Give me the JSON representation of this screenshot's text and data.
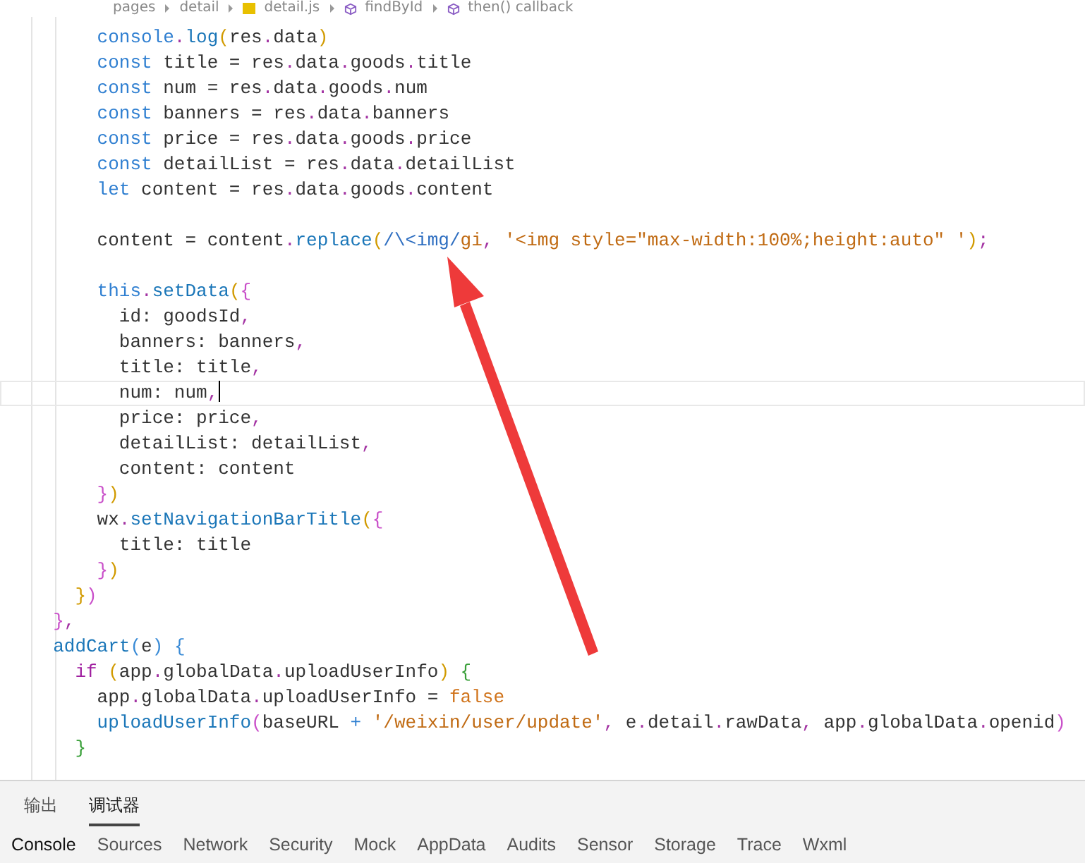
{
  "breadcrumb": [
    {
      "label": "pages",
      "kind": "folder"
    },
    {
      "label": "detail",
      "kind": "folder"
    },
    {
      "label": "detail.js",
      "kind": "file"
    },
    {
      "label": "findById",
      "kind": "method"
    },
    {
      "label": "then() callback",
      "kind": "method"
    }
  ],
  "code_lines": [
    {
      "kind": "code",
      "current": false,
      "tokens": [
        {
          "text": "      console",
          "kind": "keyword"
        },
        {
          "text": ".",
          "kind": "punct"
        },
        {
          "text": "log",
          "kind": "func"
        },
        {
          "text": "(",
          "kind": "paren"
        },
        {
          "text": "res",
          "kind": "plain"
        },
        {
          "text": ".",
          "kind": "punct"
        },
        {
          "text": "data",
          "kind": "plain"
        },
        {
          "text": ")",
          "kind": "paren"
        }
      ]
    },
    {
      "kind": "code",
      "current": false,
      "tokens": [
        {
          "text": "      const",
          "kind": "keyword"
        },
        {
          "text": " title = res",
          "kind": "plain"
        },
        {
          "text": ".",
          "kind": "punct"
        },
        {
          "text": "data",
          "kind": "plain"
        },
        {
          "text": ".",
          "kind": "punct"
        },
        {
          "text": "goods",
          "kind": "plain"
        },
        {
          "text": ".",
          "kind": "punct"
        },
        {
          "text": "title",
          "kind": "plain"
        }
      ]
    },
    {
      "kind": "code",
      "current": false,
      "tokens": [
        {
          "text": "      const",
          "kind": "keyword"
        },
        {
          "text": " num = res",
          "kind": "plain"
        },
        {
          "text": ".",
          "kind": "punct"
        },
        {
          "text": "data",
          "kind": "plain"
        },
        {
          "text": ".",
          "kind": "punct"
        },
        {
          "text": "goods",
          "kind": "plain"
        },
        {
          "text": ".",
          "kind": "punct"
        },
        {
          "text": "num",
          "kind": "plain"
        }
      ]
    },
    {
      "kind": "code",
      "current": false,
      "tokens": [
        {
          "text": "      const",
          "kind": "keyword"
        },
        {
          "text": " banners = res",
          "kind": "plain"
        },
        {
          "text": ".",
          "kind": "punct"
        },
        {
          "text": "data",
          "kind": "plain"
        },
        {
          "text": ".",
          "kind": "punct"
        },
        {
          "text": "banners",
          "kind": "plain"
        }
      ]
    },
    {
      "kind": "code",
      "current": false,
      "tokens": [
        {
          "text": "      const",
          "kind": "keyword"
        },
        {
          "text": " price = res",
          "kind": "plain"
        },
        {
          "text": ".",
          "kind": "punct"
        },
        {
          "text": "data",
          "kind": "plain"
        },
        {
          "text": ".",
          "kind": "punct"
        },
        {
          "text": "goods",
          "kind": "plain"
        },
        {
          "text": ".",
          "kind": "punct"
        },
        {
          "text": "price",
          "kind": "plain"
        }
      ]
    },
    {
      "kind": "code",
      "current": false,
      "tokens": [
        {
          "text": "      const",
          "kind": "keyword"
        },
        {
          "text": " detailList = res",
          "kind": "plain"
        },
        {
          "text": ".",
          "kind": "punct"
        },
        {
          "text": "data",
          "kind": "plain"
        },
        {
          "text": ".",
          "kind": "punct"
        },
        {
          "text": "detailList",
          "kind": "plain"
        }
      ]
    },
    {
      "kind": "code",
      "current": false,
      "tokens": [
        {
          "text": "      let",
          "kind": "keyword"
        },
        {
          "text": " content = res",
          "kind": "plain"
        },
        {
          "text": ".",
          "kind": "punct"
        },
        {
          "text": "data",
          "kind": "plain"
        },
        {
          "text": ".",
          "kind": "punct"
        },
        {
          "text": "goods",
          "kind": "plain"
        },
        {
          "text": ".",
          "kind": "punct"
        },
        {
          "text": "content",
          "kind": "plain"
        }
      ]
    },
    {
      "kind": "blank"
    },
    {
      "kind": "code",
      "current": false,
      "tokens": [
        {
          "text": "      content = content",
          "kind": "plain"
        },
        {
          "text": ".",
          "kind": "punct"
        },
        {
          "text": "replace",
          "kind": "func"
        },
        {
          "text": "(",
          "kind": "paren"
        },
        {
          "text": "/\\<img/",
          "kind": "regex"
        },
        {
          "text": "gi",
          "kind": "string"
        },
        {
          "text": ", ",
          "kind": "punct"
        },
        {
          "text": "'<img style=\"max-width:100%;height:auto\" '",
          "kind": "string"
        },
        {
          "text": ")",
          "kind": "paren"
        },
        {
          "text": ";",
          "kind": "punct"
        }
      ]
    },
    {
      "kind": "blank"
    },
    {
      "kind": "code",
      "current": false,
      "tokens": [
        {
          "text": "      this",
          "kind": "keyword"
        },
        {
          "text": ".",
          "kind": "punct"
        },
        {
          "text": "setData",
          "kind": "func"
        },
        {
          "text": "(",
          "kind": "paren"
        },
        {
          "text": "{",
          "kind": "brace"
        }
      ]
    },
    {
      "kind": "code",
      "current": false,
      "tokens": [
        {
          "text": "        id: goodsId",
          "kind": "plain"
        },
        {
          "text": ",",
          "kind": "punct"
        }
      ]
    },
    {
      "kind": "code",
      "current": false,
      "tokens": [
        {
          "text": "        banners: banners",
          "kind": "plain"
        },
        {
          "text": ",",
          "kind": "punct"
        }
      ]
    },
    {
      "kind": "code",
      "current": false,
      "tokens": [
        {
          "text": "        title: title",
          "kind": "plain"
        },
        {
          "text": ",",
          "kind": "punct"
        }
      ]
    },
    {
      "kind": "code",
      "current": true,
      "tokens": [
        {
          "text": "        num: num",
          "kind": "plain"
        },
        {
          "text": ",",
          "kind": "punct"
        }
      ]
    },
    {
      "kind": "code",
      "current": false,
      "tokens": [
        {
          "text": "        price: price",
          "kind": "plain"
        },
        {
          "text": ",",
          "kind": "punct"
        }
      ]
    },
    {
      "kind": "code",
      "current": false,
      "tokens": [
        {
          "text": "        detailList: detailList",
          "kind": "plain"
        },
        {
          "text": ",",
          "kind": "punct"
        }
      ]
    },
    {
      "kind": "code",
      "current": false,
      "tokens": [
        {
          "text": "        content: content",
          "kind": "plain"
        }
      ]
    },
    {
      "kind": "code",
      "current": false,
      "tokens": [
        {
          "text": "      }",
          "kind": "brace"
        },
        {
          "text": ")",
          "kind": "paren"
        }
      ]
    },
    {
      "kind": "code",
      "current": false,
      "tokens": [
        {
          "text": "      wx",
          "kind": "plain"
        },
        {
          "text": ".",
          "kind": "punct"
        },
        {
          "text": "setNavigationBarTitle",
          "kind": "func"
        },
        {
          "text": "(",
          "kind": "paren"
        },
        {
          "text": "{",
          "kind": "brace"
        }
      ]
    },
    {
      "kind": "code",
      "current": false,
      "tokens": [
        {
          "text": "        title: title",
          "kind": "plain"
        }
      ]
    },
    {
      "kind": "code",
      "current": false,
      "tokens": [
        {
          "text": "      }",
          "kind": "brace"
        },
        {
          "text": ")",
          "kind": "paren"
        }
      ]
    },
    {
      "kind": "code",
      "current": false,
      "tokens": [
        {
          "text": "    }",
          "kind": "paren"
        },
        {
          "text": ")",
          "kind": "brace"
        }
      ]
    },
    {
      "kind": "code",
      "current": false,
      "tokens": [
        {
          "text": "  }",
          "kind": "brace"
        },
        {
          "text": ",",
          "kind": "punct"
        }
      ]
    },
    {
      "kind": "code",
      "current": false,
      "tokens": [
        {
          "text": "  addCart",
          "kind": "func"
        },
        {
          "text": "(",
          "kind": "bracket"
        },
        {
          "text": "e",
          "kind": "plain"
        },
        {
          "text": ") {",
          "kind": "bracket"
        }
      ]
    },
    {
      "kind": "code",
      "current": false,
      "tokens": [
        {
          "text": "    if",
          "kind": "control"
        },
        {
          "text": " (",
          "kind": "paren"
        },
        {
          "text": "app",
          "kind": "plain"
        },
        {
          "text": ".",
          "kind": "punct"
        },
        {
          "text": "globalData",
          "kind": "plain"
        },
        {
          "text": ".",
          "kind": "punct"
        },
        {
          "text": "uploadUserInfo",
          "kind": "plain"
        },
        {
          "text": ")",
          "kind": "paren"
        },
        {
          "text": " {",
          "kind": "block"
        }
      ]
    },
    {
      "kind": "code",
      "current": false,
      "tokens": [
        {
          "text": "      app",
          "kind": "plain"
        },
        {
          "text": ".",
          "kind": "punct"
        },
        {
          "text": "globalData",
          "kind": "plain"
        },
        {
          "text": ".",
          "kind": "punct"
        },
        {
          "text": "uploadUserInfo = ",
          "kind": "plain"
        },
        {
          "text": "false",
          "kind": "boolean"
        }
      ]
    },
    {
      "kind": "code",
      "current": false,
      "tokens": [
        {
          "text": "      uploadUserInfo",
          "kind": "func"
        },
        {
          "text": "(",
          "kind": "brace"
        },
        {
          "text": "baseURL ",
          "kind": "plain"
        },
        {
          "text": "+ ",
          "kind": "keyword"
        },
        {
          "text": "'/weixin/user/update'",
          "kind": "string"
        },
        {
          "text": ", ",
          "kind": "punct"
        },
        {
          "text": "e",
          "kind": "plain"
        },
        {
          "text": ".",
          "kind": "punct"
        },
        {
          "text": "detail",
          "kind": "plain"
        },
        {
          "text": ".",
          "kind": "punct"
        },
        {
          "text": "rawData",
          "kind": "plain"
        },
        {
          "text": ", ",
          "kind": "punct"
        },
        {
          "text": "app",
          "kind": "plain"
        },
        {
          "text": ".",
          "kind": "punct"
        },
        {
          "text": "globalData",
          "kind": "plain"
        },
        {
          "text": ".",
          "kind": "punct"
        },
        {
          "text": "openid",
          "kind": "plain"
        },
        {
          "text": ")",
          "kind": "brace"
        }
      ]
    },
    {
      "kind": "code",
      "current": false,
      "tokens": [
        {
          "text": "    }",
          "kind": "block"
        }
      ]
    }
  ],
  "panel_tabs": [
    {
      "label": "输出",
      "selected": false
    },
    {
      "label": "调试器",
      "selected": true
    }
  ],
  "devtools_tabs": [
    {
      "label": "Console",
      "selected": true
    },
    {
      "label": "Sources",
      "selected": false
    },
    {
      "label": "Network",
      "selected": false
    },
    {
      "label": "Security",
      "selected": false
    },
    {
      "label": "Mock",
      "selected": false
    },
    {
      "label": "AppData",
      "selected": false
    },
    {
      "label": "Audits",
      "selected": false
    },
    {
      "label": "Sensor",
      "selected": false
    },
    {
      "label": "Storage",
      "selected": false
    },
    {
      "label": "Trace",
      "selected": false
    },
    {
      "label": "Wxml",
      "selected": false
    }
  ]
}
